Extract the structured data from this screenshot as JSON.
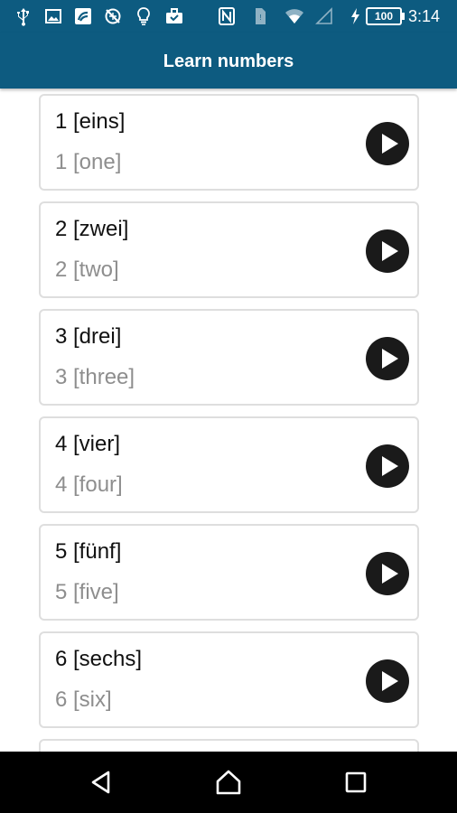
{
  "status_bar": {
    "icons": [
      "usb-icon",
      "image-icon",
      "app-icon",
      "no-location-icon",
      "lightbulb-icon",
      "briefcase-icon",
      "nfc-icon",
      "sim-icon",
      "wifi-icon",
      "signal-icon",
      "charging-icon"
    ],
    "battery": "100",
    "time": "3:14"
  },
  "app_bar": {
    "title": "Learn numbers"
  },
  "items": [
    {
      "german": "1 [eins]",
      "english": "1 [one]"
    },
    {
      "german": "2 [zwei]",
      "english": "2 [two]"
    },
    {
      "german": "3 [drei]",
      "english": "3 [three]"
    },
    {
      "german": "4 [vier]",
      "english": "4 [four]"
    },
    {
      "german": "5 [fünf]",
      "english": "5 [five]"
    },
    {
      "german": "6 [sechs]",
      "english": "6 [six]"
    }
  ],
  "nav_bar": {
    "icons": [
      "back-icon",
      "home-icon",
      "recents-icon"
    ]
  },
  "colors": {
    "primary": "#0d5b80",
    "card_border": "#dedede",
    "secondary_text": "#8e8e8e",
    "play_button": "#1a1a1a"
  }
}
